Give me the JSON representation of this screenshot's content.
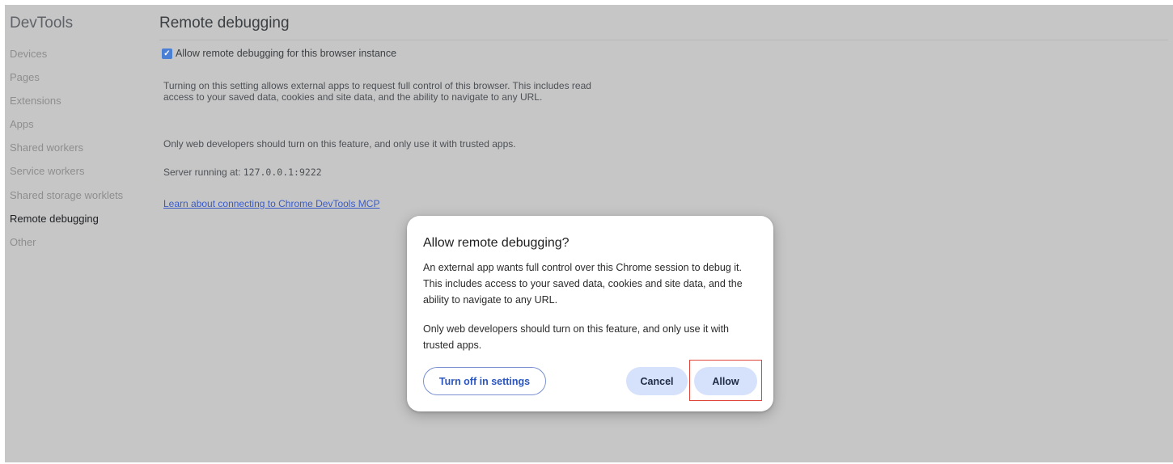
{
  "sidebar": {
    "title": "DevTools",
    "items": [
      {
        "label": "Devices",
        "active": false
      },
      {
        "label": "Pages",
        "active": false
      },
      {
        "label": "Extensions",
        "active": false
      },
      {
        "label": "Apps",
        "active": false
      },
      {
        "label": "Shared workers",
        "active": false
      },
      {
        "label": "Service workers",
        "active": false
      },
      {
        "label": "Shared storage worklets",
        "active": false
      },
      {
        "label": "Remote debugging",
        "active": true
      },
      {
        "label": "Other",
        "active": false
      }
    ]
  },
  "main": {
    "title": "Remote debugging",
    "checkbox_label": "Allow remote debugging for this browser instance",
    "checkbox_checked": true,
    "paragraph1": "Turning on this setting allows external apps to request full control of this browser. This includes read access to your saved data, cookies and site data, and the ability to navigate to any URL.",
    "paragraph2": "Only web developers should turn on this feature, and only use it with trusted apps.",
    "server_label": "Server running at:",
    "server_address": "127.0.0.1:9222",
    "learn_link": "Learn about connecting to Chrome DevTools MCP"
  },
  "dialog": {
    "title": "Allow remote debugging?",
    "body1": "An external app wants full control over this Chrome session to debug it. This includes access to your saved data, cookies and site data, and the ability to navigate to any URL.",
    "body2": "Only web developers should turn on this feature, and only use it with trusted apps.",
    "turn_off_label": "Turn off in settings",
    "cancel_label": "Cancel",
    "allow_label": "Allow"
  },
  "colors": {
    "overlay_background": "#c6c6c6",
    "link": "#3a5bc7",
    "primary_button": "#d6e2fb",
    "highlight": "#e0453a"
  }
}
